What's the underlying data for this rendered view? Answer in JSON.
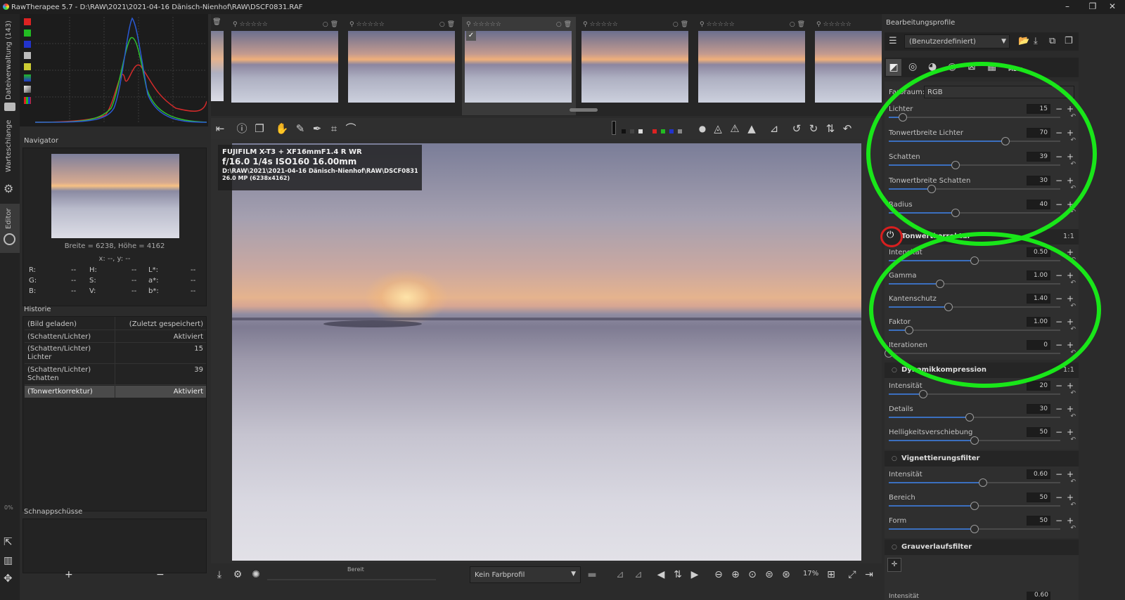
{
  "window": {
    "title": "RawTherapee 5.7 - D:\\RAW\\2021\\2021-04-16 Dänisch-Nienhof\\RAW\\DSCF0831.RAF"
  },
  "vtabs": [
    "Dateiverwaltung (143)",
    "Warteschlange",
    "Editor"
  ],
  "vtab_progress": "0%",
  "navigator": {
    "title": "Navigator",
    "size": "Breite = 6238, Höhe = 4162",
    "xy": "x: --, y: --",
    "readouts": [
      [
        "R:",
        "--",
        "H:",
        "--",
        "L*:",
        "--"
      ],
      [
        "G:",
        "--",
        "S:",
        "--",
        "a*:",
        "--"
      ],
      [
        "B:",
        "--",
        "V:",
        "--",
        "b*:",
        "--"
      ]
    ]
  },
  "history": {
    "title": "Historie",
    "rows": [
      {
        "name": "(Bild geladen)",
        "value": "(Zuletzt gespeichert)"
      },
      {
        "name": "(Schatten/Lichter)",
        "value": "Aktiviert"
      },
      {
        "name": "(Schatten/Lichter)\nLichter",
        "value": "15"
      },
      {
        "name": "(Schatten/Lichter)\nSchatten",
        "value": "39"
      },
      {
        "name": "(Tonwertkorrektur)",
        "value": "Aktiviert"
      }
    ]
  },
  "snapshots": {
    "title": "Schnappschüsse",
    "add": "+",
    "remove": "−"
  },
  "photo_info": {
    "camera": "FUJIFILM X-T3 + XF16mmF1.4 R WR",
    "exposure": "f/16.0  1/4s  ISO160  16.00mm",
    "path": "D:\\RAW\\2021\\2021-04-16 Dänisch-Nienhof\\RAW\\DSCF0831.RAF",
    "size": "26.0 MP (6238x4162)"
  },
  "bottom": {
    "status": "Bereit",
    "profile": "Kein Farbprofil",
    "zoom": "17%"
  },
  "right": {
    "profiles_title": "Bearbeitungsprofile",
    "profile_value": "(Benutzerdefiniert)",
    "meta_label": "META",
    "farbraum_label": "Farbraum:",
    "farbraum_value": "RGB",
    "sliders_a": [
      {
        "label": "Lichter",
        "value": "15",
        "fill": 0.08
      },
      {
        "label": "Tonwertbreite Lichter",
        "value": "70",
        "fill": 0.68
      },
      {
        "label": "Schatten",
        "value": "39",
        "fill": 0.39
      },
      {
        "label": "Tonwertbreite Schatten",
        "value": "30",
        "fill": 0.25
      },
      {
        "label": "Radius",
        "value": "40",
        "fill": 0.39
      }
    ],
    "section_tonwert": "Tonwertkorrektur",
    "section_tonwert_visible": "Tonwertkorrektur",
    "sliders_b": [
      {
        "label": "Intensität",
        "value": "0.50",
        "fill": 0.5
      },
      {
        "label": "Gamma",
        "value": "1.00",
        "fill": 0.3
      },
      {
        "label": "Kantenschutz",
        "value": "1.40",
        "fill": 0.35
      },
      {
        "label": "Faktor",
        "value": "1.00",
        "fill": 0.12
      },
      {
        "label": "Iterationen",
        "value": "0",
        "fill": 0.0
      }
    ],
    "section_dynamik": "Dynamikkompression",
    "sliders_c": [
      {
        "label": "Intensität",
        "value": "20",
        "fill": 0.2
      },
      {
        "label": "Details",
        "value": "30",
        "fill": 0.47
      },
      {
        "label": "Helligkeitsverschiebung",
        "value": "50",
        "fill": 0.5
      }
    ],
    "section_vignette": "Vignettierungsfilter",
    "sliders_d": [
      {
        "label": "Intensität",
        "value": "0.60",
        "fill": 0.55
      },
      {
        "label": "Bereich",
        "value": "50",
        "fill": 0.5
      },
      {
        "label": "Form",
        "value": "50",
        "fill": 0.5
      }
    ],
    "section_grau": "Grauverlaufsfilter",
    "grau_partial_label": "Intensität",
    "grau_partial_value": "0.60",
    "one_to_one": "1:1"
  },
  "colors": {
    "accent": "#3b6fbf",
    "highlight": "#19e619",
    "power_ring": "#d81f1f"
  }
}
